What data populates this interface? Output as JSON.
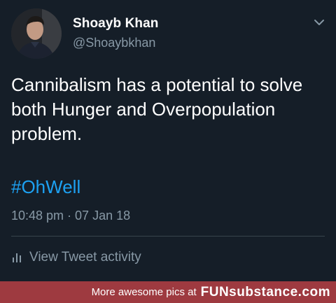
{
  "author": {
    "display_name": "Shoayb Khan",
    "handle": "@Shoaybkhan",
    "avatar_icon": "profile-photo"
  },
  "tweet": {
    "text": "Cannibalism has a potential to solve both Hunger and Overpopulation problem.",
    "hashtag": "#OhWell",
    "timestamp": "10:48 pm · 07 Jan 18"
  },
  "menu": {
    "icon": "chevron-down-icon"
  },
  "activity": {
    "label": "View Tweet activity",
    "icon": "bar-chart-icon"
  },
  "watermark": {
    "text": "More awesome pics at",
    "brand": "FUNsubstance.com"
  },
  "colors": {
    "background": "#151e28",
    "link": "#1da1f2",
    "secondary_text": "#8899a6",
    "watermark_bar": "#9e3a40"
  }
}
